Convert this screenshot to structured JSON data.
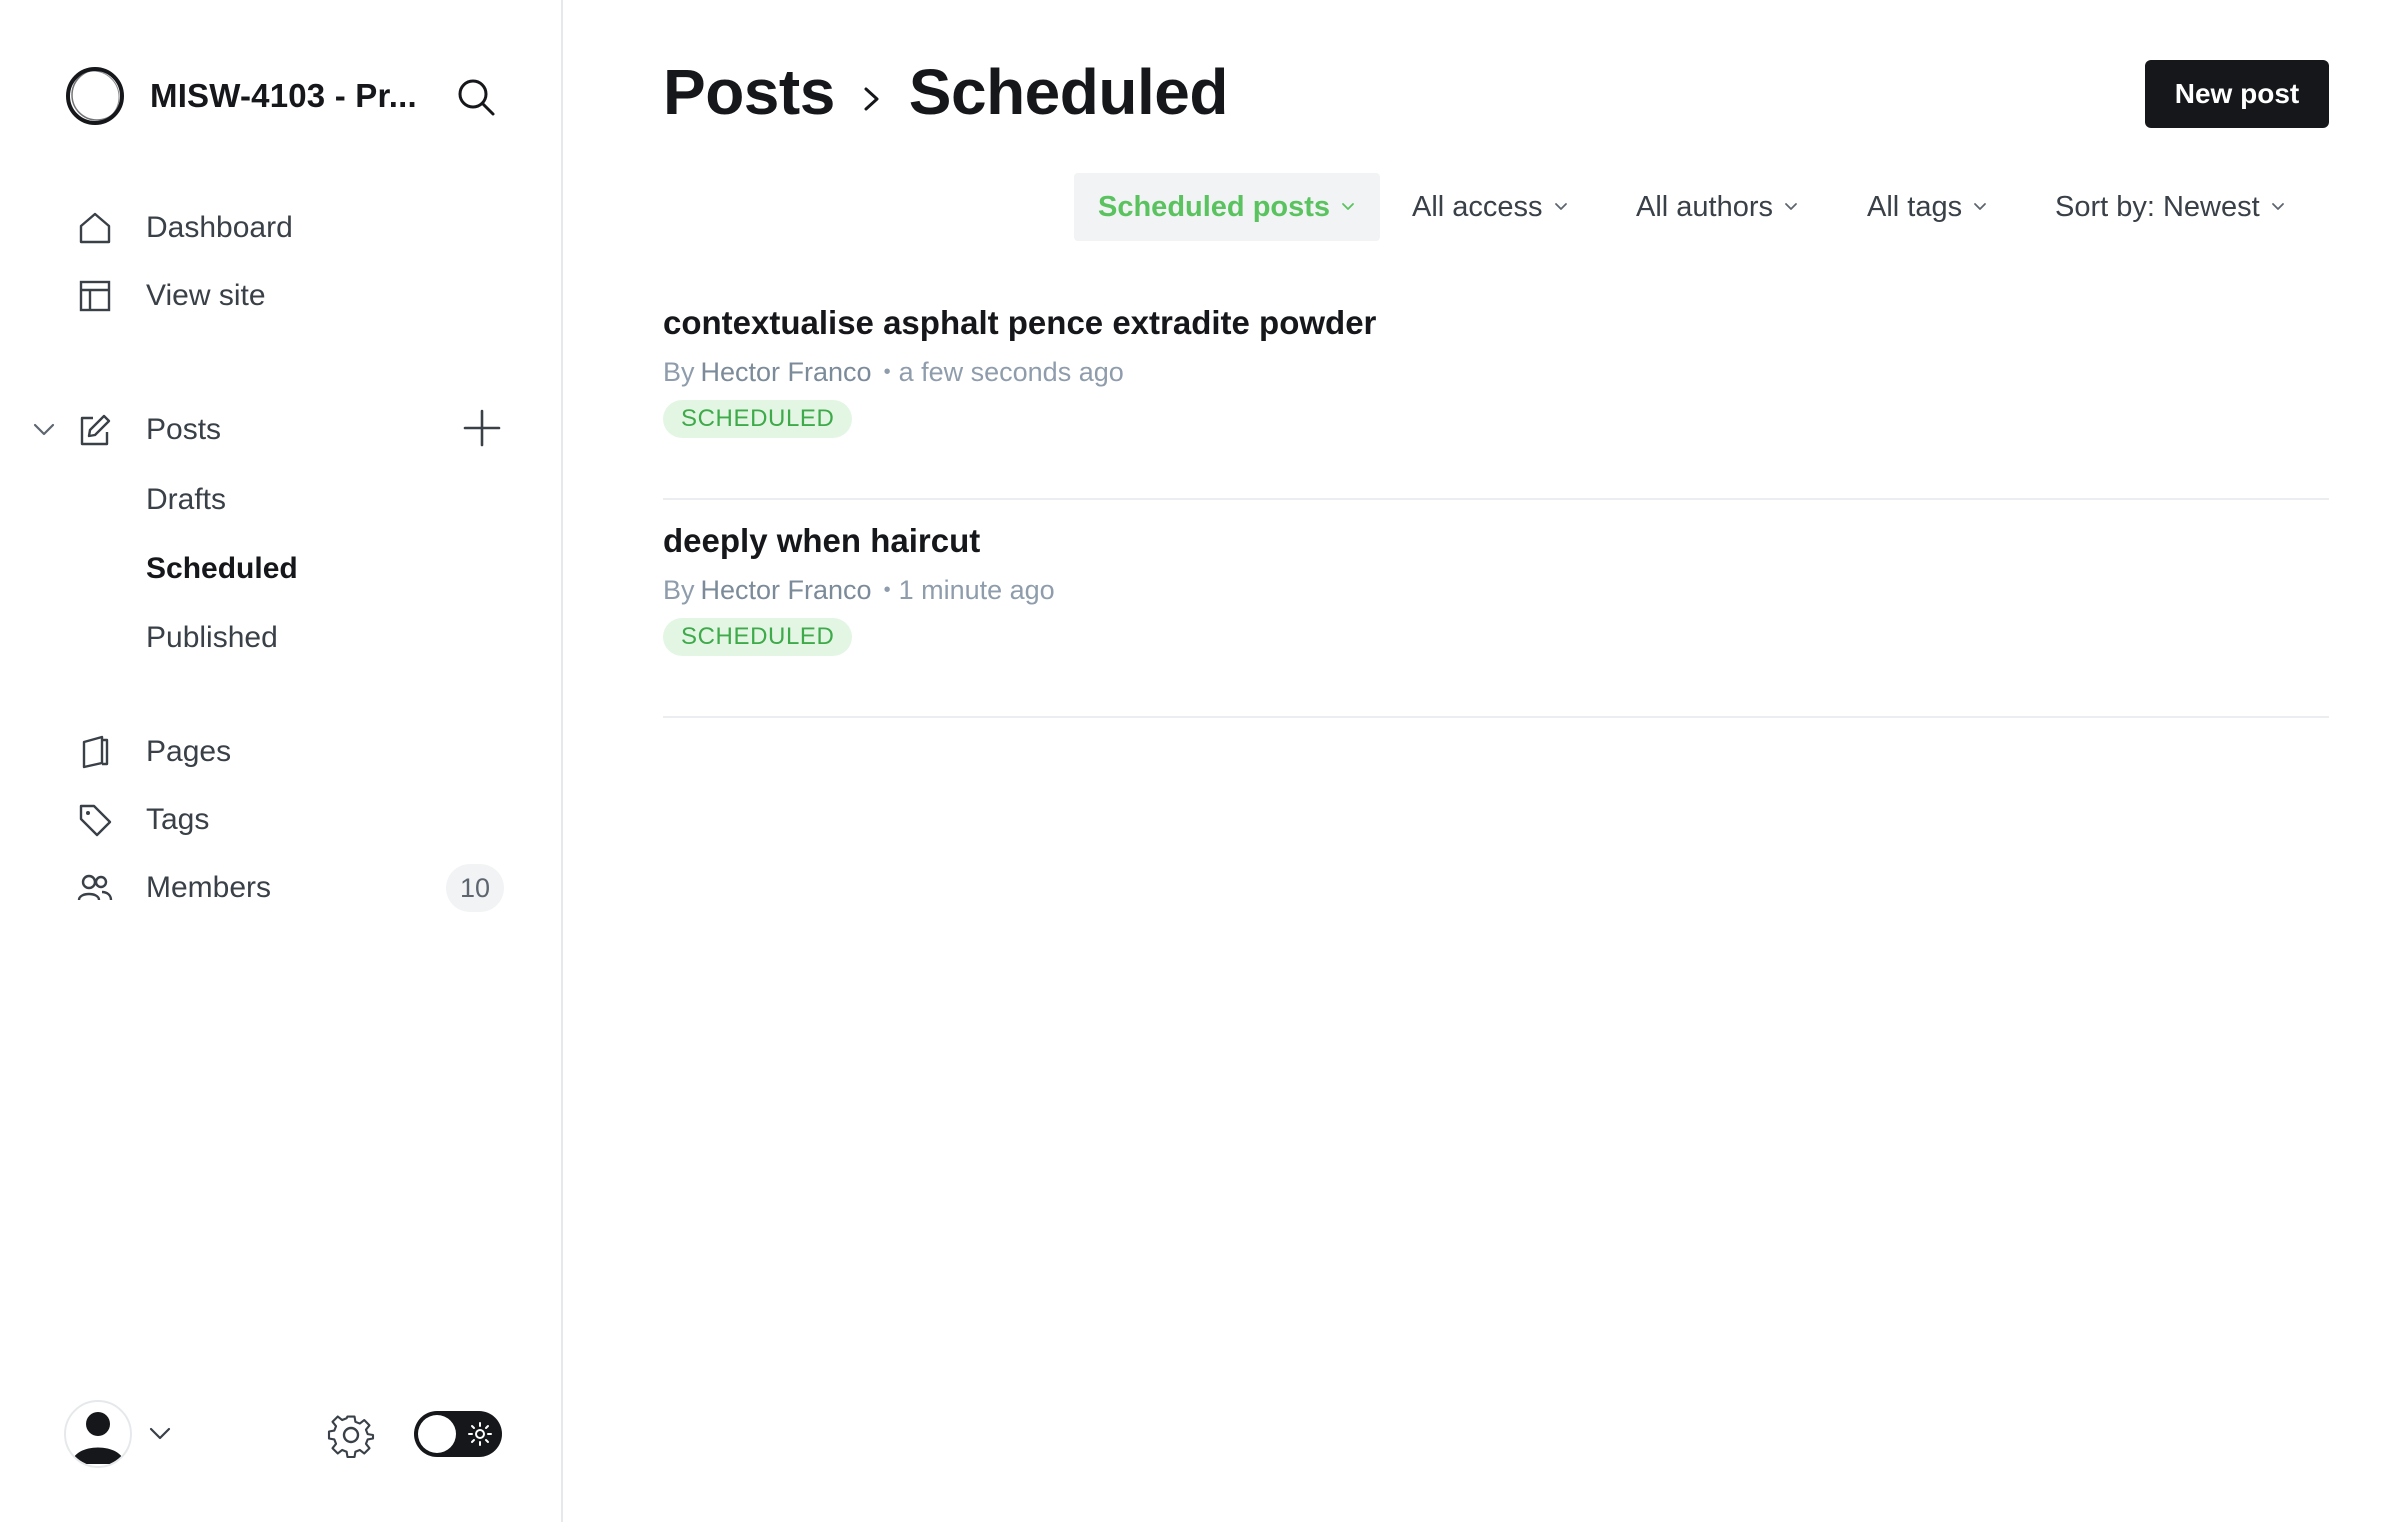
{
  "sidebar": {
    "brand_title": "MISW-4103 - Pr...",
    "nav": {
      "dashboard": "Dashboard",
      "view_site": "View site",
      "posts": "Posts",
      "drafts": "Drafts",
      "scheduled": "Scheduled",
      "published": "Published",
      "pages": "Pages",
      "tags": "Tags",
      "members": "Members",
      "members_count": "10"
    }
  },
  "header": {
    "breadcrumb_root": "Posts",
    "breadcrumb_current": "Scheduled",
    "new_post_label": "New post"
  },
  "filters": {
    "type": "Scheduled posts",
    "access": "All access",
    "authors": "All authors",
    "tags": "All tags",
    "sort": "Sort by: Newest"
  },
  "posts": [
    {
      "title": "contextualise asphalt pence extradite powder",
      "by": "By",
      "author": "Hector Franco",
      "time": "a few seconds ago",
      "status": "SCHEDULED"
    },
    {
      "title": "deeply when haircut",
      "by": "By",
      "author": "Hector Franco",
      "time": "1 minute ago",
      "status": "SCHEDULED"
    }
  ],
  "colors": {
    "accent_green": "#5ac35f",
    "badge_bg": "#e3f6e4",
    "primary_dark": "#15171a"
  }
}
